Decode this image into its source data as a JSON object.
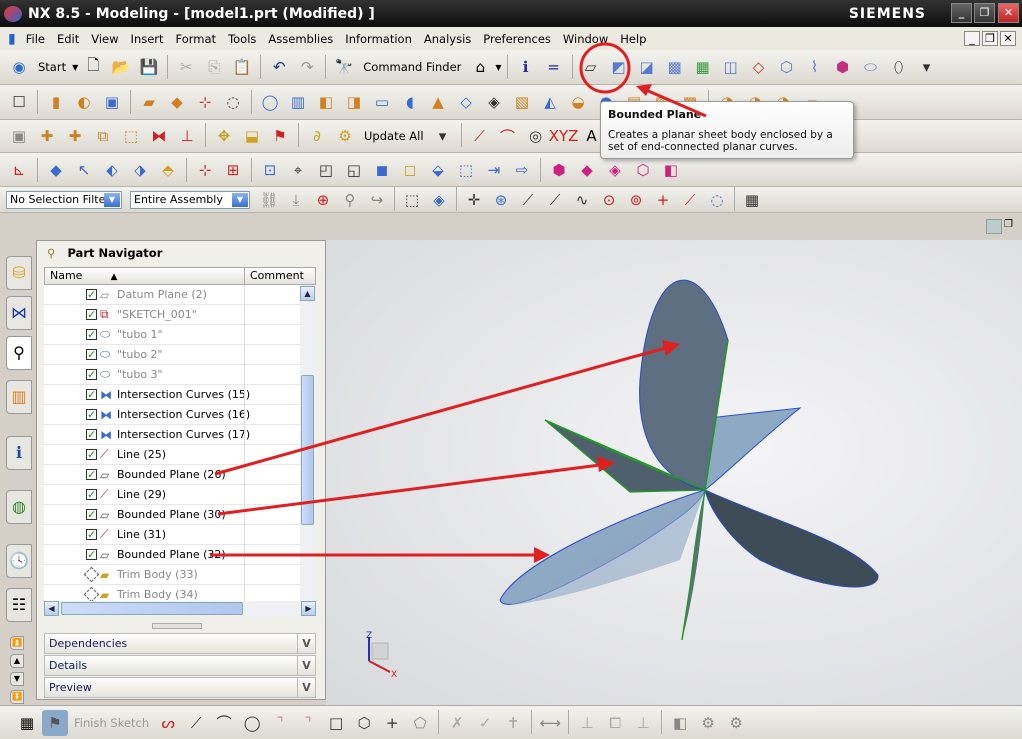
{
  "window": {
    "title": "NX 8.5 - Modeling - [model1.prt (Modified) ]",
    "brand": "SIEMENS"
  },
  "menu": [
    "File",
    "Edit",
    "View",
    "Insert",
    "Format",
    "Tools",
    "Assemblies",
    "Information",
    "Analysis",
    "Preferences",
    "Window",
    "Help"
  ],
  "toolbar": {
    "start_label": "Start",
    "command_finder_label": "Command Finder",
    "update_all_label": "Update All",
    "text_icon": "A",
    "xyz_icon": "XYZ="
  },
  "selection_bar": {
    "filter": "No Selection Filter",
    "scope": "Entire Assembly"
  },
  "tooltip": {
    "title": "Bounded Plane",
    "text": "Creates a planar sheet body enclosed by a set of end-connected planar curves."
  },
  "navigator": {
    "title": "Part Navigator",
    "columns": [
      "Name",
      "Comment"
    ],
    "items": [
      {
        "label": "Datum Plane (2)",
        "icon": "datum-plane-icon",
        "checked": true,
        "dim": true
      },
      {
        "label": "\"SKETCH_001\"",
        "icon": "sketch-icon",
        "checked": true,
        "dim": true
      },
      {
        "label": "\"tubo 1\"",
        "icon": "tube-icon",
        "checked": true,
        "dim": true
      },
      {
        "label": "\"tubo 2\"",
        "icon": "tube-icon",
        "checked": true,
        "dim": true
      },
      {
        "label": "\"tubo 3\"",
        "icon": "tube-icon",
        "checked": true,
        "dim": true
      },
      {
        "label": "Intersection Curves (15)",
        "icon": "intersection-curve-icon",
        "checked": true,
        "dim": false
      },
      {
        "label": "Intersection Curves (16)",
        "icon": "intersection-curve-icon",
        "checked": true,
        "dim": false
      },
      {
        "label": "Intersection Curves (17)",
        "icon": "intersection-curve-icon",
        "checked": true,
        "dim": false
      },
      {
        "label": "Line (25)",
        "icon": "line-icon",
        "checked": true,
        "dim": false
      },
      {
        "label": "Bounded Plane (26)",
        "icon": "bounded-plane-icon",
        "checked": true,
        "dim": false
      },
      {
        "label": "Line (29)",
        "icon": "line-icon",
        "checked": true,
        "dim": false
      },
      {
        "label": "Bounded Plane (30)",
        "icon": "bounded-plane-icon",
        "checked": true,
        "dim": false
      },
      {
        "label": "Line (31)",
        "icon": "line-icon",
        "checked": true,
        "dim": false
      },
      {
        "label": "Bounded Plane (32)",
        "icon": "bounded-plane-icon",
        "checked": true,
        "dim": false
      },
      {
        "label": "Trim Body (33)",
        "icon": "trim-body-icon",
        "checked": false,
        "dim": true
      },
      {
        "label": "Trim Body (34)",
        "icon": "trim-body-icon",
        "checked": false,
        "dim": true
      }
    ],
    "panels": [
      "Dependencies",
      "Details",
      "Preview"
    ]
  },
  "triad": {
    "z": "Z",
    "x": "X"
  },
  "sketch_bar": {
    "finish_label": "Finish Sketch"
  },
  "colors": {
    "highlight": "#e02020",
    "plane_dark": "#4f5f6e",
    "plane_light": "#8ea9c4",
    "edge": "#1f9a1f"
  }
}
